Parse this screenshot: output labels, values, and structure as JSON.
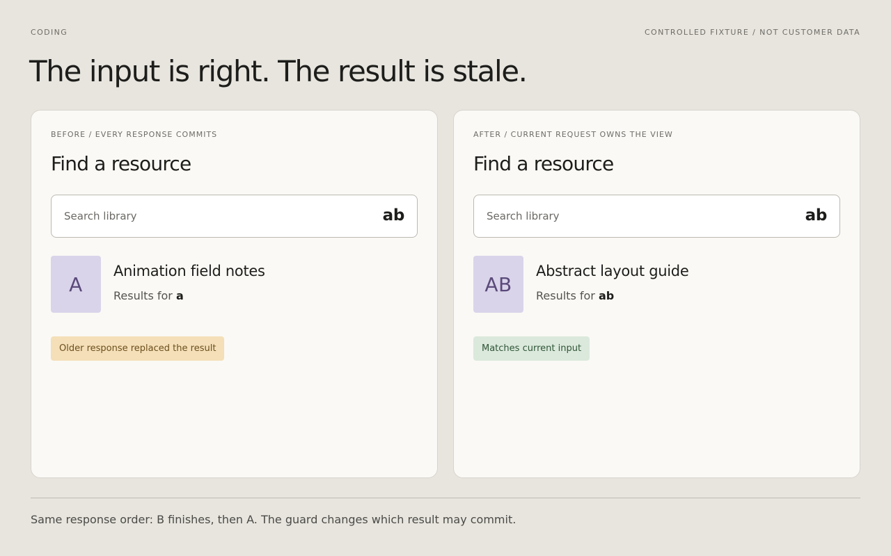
{
  "header": {
    "category": "CODING",
    "fixture_note": "CONTROLLED FIXTURE / NOT CUSTOMER DATA",
    "headline": "The input is right. The result is stale."
  },
  "panels": [
    {
      "label": "BEFORE / EVERY RESPONSE COMMITS",
      "title": "Find a resource",
      "search_placeholder": "Search library",
      "search_value": "ab",
      "result": {
        "tile": "A",
        "name": "Animation field notes",
        "sub_prefix": "Results for",
        "sub_query": "a"
      },
      "badge": "Older response replaced the result",
      "badge_color": "#f4dfb8"
    },
    {
      "label": "AFTER / CURRENT REQUEST OWNS THE VIEW",
      "title": "Find a resource",
      "search_placeholder": "Search library",
      "search_value": "ab",
      "result": {
        "tile": "AB",
        "name": "Abstract layout guide",
        "sub_prefix": "Results for",
        "sub_query": "ab"
      },
      "badge": "Matches current input",
      "badge_color": "#dbe9dc"
    }
  ],
  "footer": {
    "note": "Same response order: B finishes, then A. The guard changes which result may commit."
  }
}
